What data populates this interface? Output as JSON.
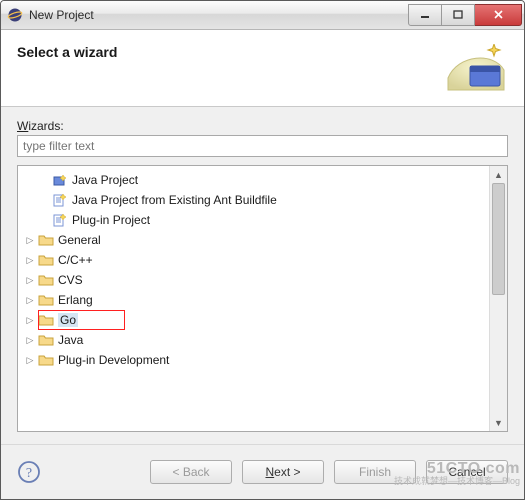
{
  "window": {
    "title": "New Project"
  },
  "banner": {
    "title": "Select a wizard"
  },
  "body": {
    "wizards_label": "Wizards:",
    "filter_placeholder": "type filter text"
  },
  "tree": {
    "items": [
      {
        "label": "Java Project",
        "kind": "wizard",
        "expandable": false
      },
      {
        "label": "Java Project from Existing Ant Buildfile",
        "kind": "wizard",
        "expandable": false
      },
      {
        "label": "Plug-in Project",
        "kind": "wizard",
        "expandable": false
      },
      {
        "label": "General",
        "kind": "folder",
        "expandable": true
      },
      {
        "label": "C/C++",
        "kind": "folder",
        "expandable": true
      },
      {
        "label": "CVS",
        "kind": "folder",
        "expandable": true
      },
      {
        "label": "Erlang",
        "kind": "folder",
        "expandable": true
      },
      {
        "label": "Go",
        "kind": "folder",
        "expandable": true,
        "selected": true
      },
      {
        "label": "Java",
        "kind": "folder",
        "expandable": true
      },
      {
        "label": "Plug-in Development",
        "kind": "folder",
        "expandable": true
      }
    ]
  },
  "buttons": {
    "back": "< Back",
    "next": "Next >",
    "finish": "Finish",
    "cancel": "Cancel"
  },
  "watermark": {
    "line1": "51CTO.com",
    "line2": "技术成就梦想—技术博客—Blog"
  }
}
